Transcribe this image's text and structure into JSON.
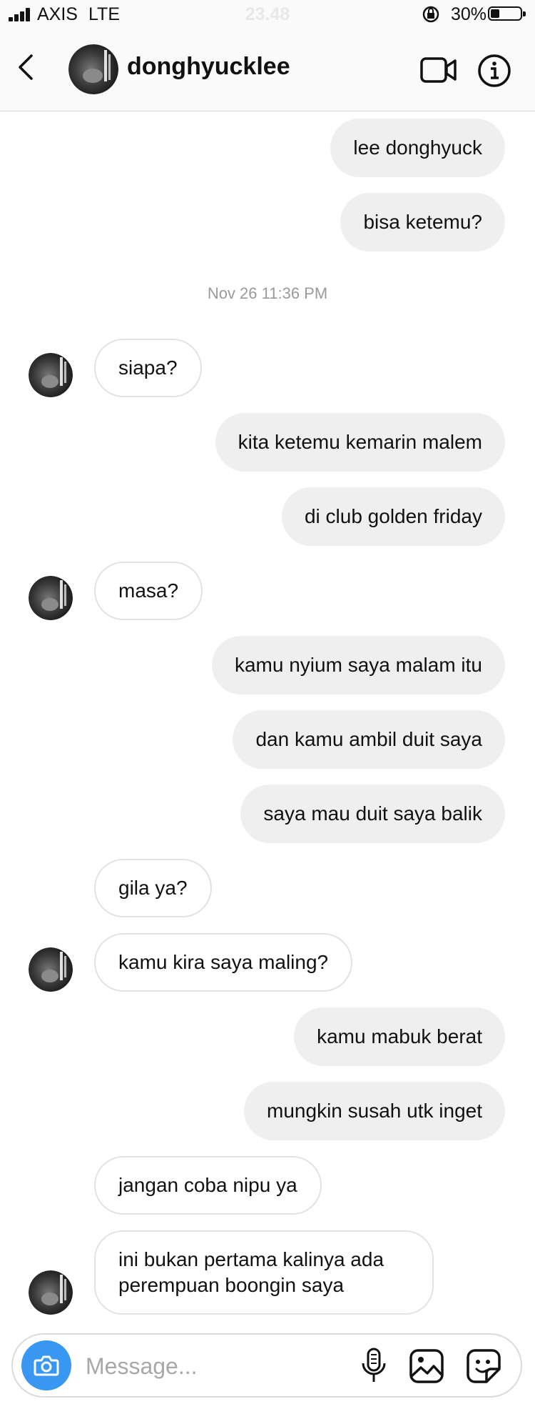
{
  "status_bar": {
    "carrier": "AXIS",
    "network": "LTE",
    "time": "23.48",
    "battery_percent": "30%",
    "battery_level": 0.3,
    "icons": [
      "signal-icon",
      "orientation-lock-icon",
      "battery-icon"
    ]
  },
  "header": {
    "username": "donghyucklee",
    "icons": [
      "back-arrow-icon",
      "avatar",
      "video-camera-icon",
      "info-icon"
    ]
  },
  "messages": [
    {
      "from": "me",
      "text": "lee donghyuck"
    },
    {
      "from": "me",
      "text": "bisa ketemu?"
    },
    {
      "timestamp": "Nov 26 11:36 PM"
    },
    {
      "from": "them",
      "text": "siapa?"
    },
    {
      "from": "me",
      "text": "kita ketemu kemarin malem"
    },
    {
      "from": "me",
      "text": "di club golden friday"
    },
    {
      "from": "them",
      "text": "masa?"
    },
    {
      "from": "me",
      "text": "kamu nyium saya malam itu"
    },
    {
      "from": "me",
      "text": "dan kamu ambil duit saya"
    },
    {
      "from": "me",
      "text": "saya mau duit saya balik"
    },
    {
      "from": "them",
      "text": "gila ya?"
    },
    {
      "from": "them",
      "text": "kamu kira saya maling?"
    },
    {
      "from": "me",
      "text": "kamu mabuk berat"
    },
    {
      "from": "me",
      "text": "mungkin susah utk inget"
    },
    {
      "from": "them",
      "text": "jangan coba nipu ya"
    },
    {
      "from": "them",
      "text": "ini bukan pertama kalinya ada perempuan boongin saya"
    }
  ],
  "composer": {
    "placeholder": "Message...",
    "icons": [
      "camera-icon",
      "microphone-icon",
      "gallery-icon",
      "sticker-icon"
    ]
  },
  "colors": {
    "accent_blue": "#3897f0",
    "outgoing_bubble": "#efefef",
    "incoming_border": "#e2e2e2"
  }
}
